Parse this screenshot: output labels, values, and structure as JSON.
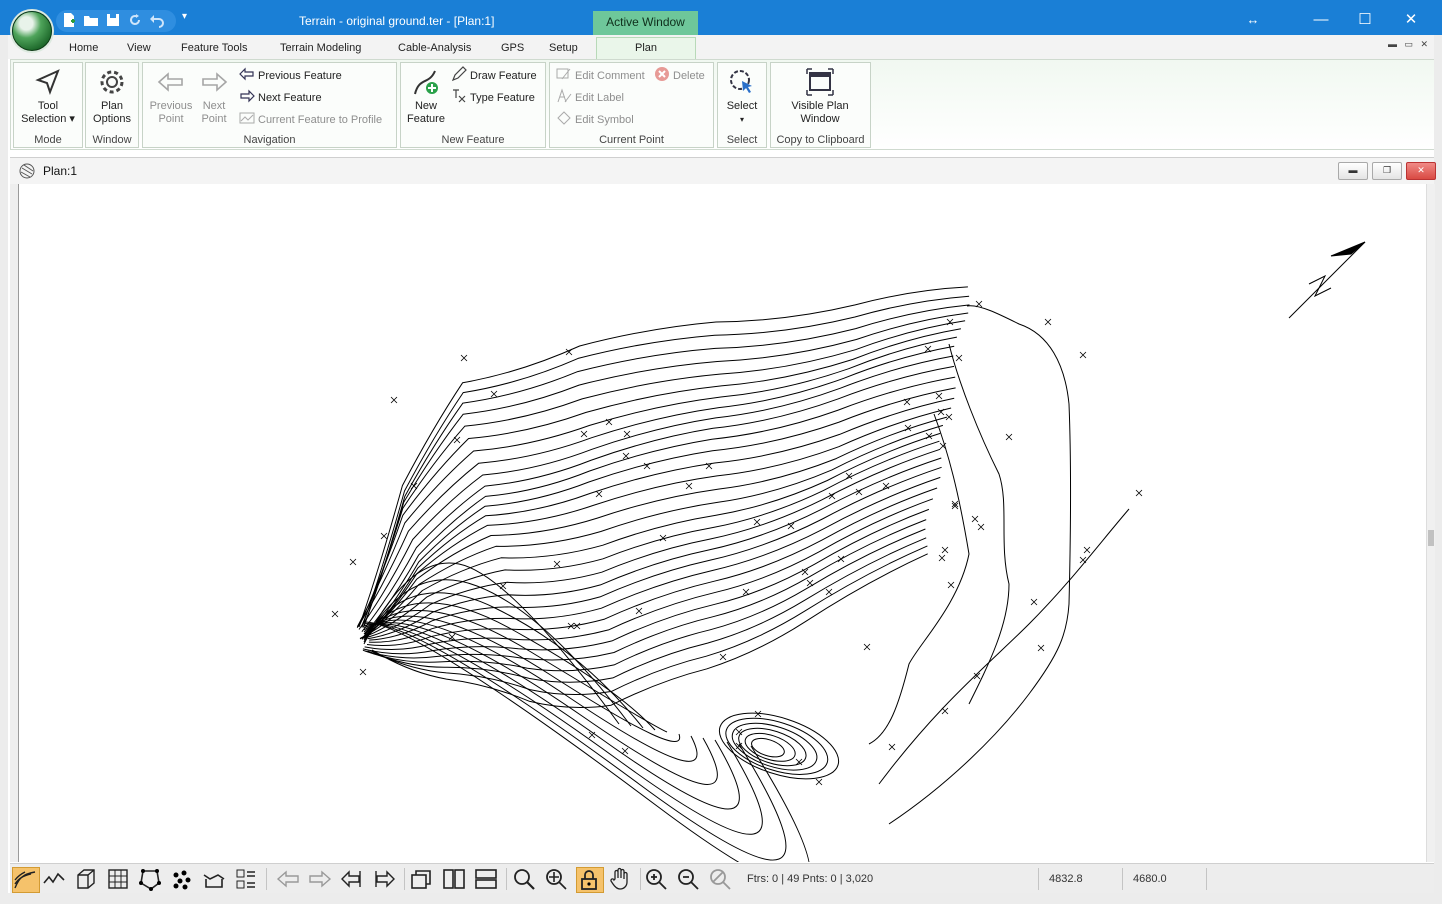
{
  "window": {
    "title": "Terrain - original ground.ter - [Plan:1]",
    "active_window_label": "Active Window",
    "controls": {
      "resize": "↔",
      "minimize": "—",
      "maximize": "☐",
      "close": "✕"
    }
  },
  "quick_access": {
    "icons": [
      "new-file-icon",
      "open-folder-icon",
      "save-icon",
      "redo-icon",
      "undo-icon"
    ],
    "more": "▾"
  },
  "tabs": [
    "Home",
    "View",
    "Feature Tools",
    "Terrain Modeling",
    "Cable-Analysis",
    "GPS",
    "Setup",
    "Plan"
  ],
  "active_tab": "Plan",
  "ribbon": {
    "mode": {
      "label": "Mode",
      "tool_selection": "Tool\nSelection ▾"
    },
    "window": {
      "label": "Window",
      "plan_options": "Plan\nOptions"
    },
    "navigation": {
      "label": "Navigation",
      "previous_point": "Previous\nPoint",
      "next_point": "Next\nPoint",
      "previous_feature": "Previous Feature",
      "next_feature": "Next Feature",
      "current_feature_to_profile": "Current Feature to Profile"
    },
    "new_feature": {
      "label": "New Feature",
      "new_feature": "New\nFeature",
      "draw_feature": "Draw Feature",
      "type_feature": "Type Feature"
    },
    "current_point": {
      "label": "Current Point",
      "edit_comment": "Edit Comment",
      "delete": "Delete",
      "edit_label": "Edit Label",
      "edit_symbol": "Edit Symbol"
    },
    "select": {
      "label": "Select",
      "select": "Select"
    },
    "copy": {
      "label": "Copy to Clipboard",
      "visible_plan_window": "Visible Plan\nWindow"
    }
  },
  "document": {
    "title": "Plan:1"
  },
  "colors": {
    "titlebar": "#1a7fd6",
    "active_window": "#6ec79a",
    "ribbon": "#eaf6ea",
    "lock_highlight": "#f5c26b"
  },
  "status": {
    "features_points": "Ftrs: 0 | 49  Pnts: 0 | 3,020",
    "x_coord": "4832.8",
    "y_coord": "4680.0"
  }
}
